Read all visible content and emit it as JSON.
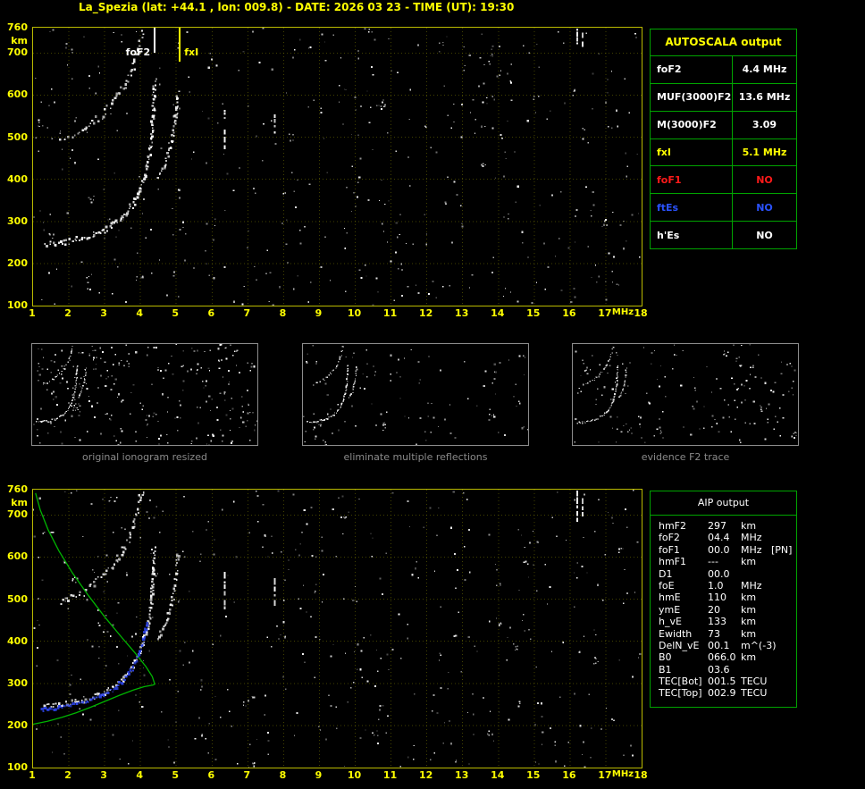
{
  "header": {
    "title": "La_Spezia (lat: +44.1 , lon: 009.8) - DATE: 2026 03 23 - TIME (UT): 19:30"
  },
  "autoscala_table": {
    "title": "AUTOSCALA output",
    "rows": [
      {
        "label": "foF2",
        "value": "4.4 MHz",
        "color": "#ffffff"
      },
      {
        "label": "MUF(3000)F2",
        "value": "13.6 MHz",
        "color": "#ffffff"
      },
      {
        "label": "M(3000)F2",
        "value": "3.09",
        "color": "#ffffff"
      },
      {
        "label": "fxI",
        "value": "5.1 MHz",
        "color": "#ffff00"
      },
      {
        "label": "foF1",
        "value": "NO",
        "color": "#ff1a1a"
      },
      {
        "label": "ftEs",
        "value": "NO",
        "color": "#2a52ff"
      },
      {
        "label": "h'Es",
        "value": "NO",
        "color": "#ffffff"
      }
    ]
  },
  "aip_table": {
    "title": "AIP output",
    "rows": [
      {
        "label": "hmF2",
        "value": "297",
        "unit": "km",
        "extra": ""
      },
      {
        "label": "foF2",
        "value": "04.4",
        "unit": "MHz",
        "extra": ""
      },
      {
        "label": "foF1",
        "value": "00.0",
        "unit": "MHz",
        "extra": "[PN]"
      },
      {
        "label": "hmF1",
        "value": "---",
        "unit": "km",
        "extra": ""
      },
      {
        "label": "D1",
        "value": "00.0",
        "unit": "",
        "extra": ""
      },
      {
        "label": "foE",
        "value": "1.0",
        "unit": "MHz",
        "extra": ""
      },
      {
        "label": "hmE",
        "value": "110",
        "unit": "km",
        "extra": ""
      },
      {
        "label": "ymE",
        "value": "20",
        "unit": "km",
        "extra": ""
      },
      {
        "label": "h_vE",
        "value": "133",
        "unit": "km",
        "extra": ""
      },
      {
        "label": "Ewidth",
        "value": "73",
        "unit": "km",
        "extra": ""
      },
      {
        "label": "DelN_vE",
        "value": "00.1",
        "unit": "m^(-3)",
        "extra": ""
      },
      {
        "label": "B0",
        "value": "066.0",
        "unit": "km",
        "extra": ""
      },
      {
        "label": "B1",
        "value": "03.6",
        "unit": "",
        "extra": ""
      },
      {
        "label": "TEC[Bot]",
        "value": "001.5",
        "unit": "TECU",
        "extra": ""
      },
      {
        "label": "TEC[Top]",
        "value": "002.9",
        "unit": "TECU",
        "extra": ""
      }
    ]
  },
  "thumbnails": [
    {
      "caption": "original ionogram resized"
    },
    {
      "caption": "eliminate multiple reflections"
    },
    {
      "caption": "evidence F2 trace"
    }
  ],
  "chart_data": {
    "type": "scatter",
    "title": "Ionogram - virtual height (km) vs sounding frequency (MHz)",
    "x_axis": {
      "label": "MHz",
      "min": 1,
      "max": 18,
      "ticks": [
        1,
        2,
        3,
        4,
        5,
        6,
        7,
        8,
        9,
        10,
        11,
        12,
        13,
        14,
        15,
        16,
        17,
        18
      ]
    },
    "y_axis": {
      "label": "km",
      "min": 100,
      "max": 760,
      "ticks": [
        100,
        200,
        300,
        400,
        500,
        600,
        700,
        760
      ]
    },
    "grid_color": "#6e6e00",
    "dot_color": "#ffffff",
    "markers": [
      {
        "name": "foF2",
        "freq": 4.4,
        "color": "#ffffff"
      },
      {
        "name": "fxI",
        "freq": 5.1,
        "color": "#ffff00"
      }
    ],
    "traces": {
      "f2_ordinary": [
        [
          1.35,
          247
        ],
        [
          1.7,
          249
        ],
        [
          2.05,
          253
        ],
        [
          2.4,
          259
        ],
        [
          2.75,
          268
        ],
        [
          3.05,
          281
        ],
        [
          3.35,
          298
        ],
        [
          3.6,
          318
        ],
        [
          3.85,
          348
        ],
        [
          4.05,
          388
        ],
        [
          4.2,
          432
        ],
        [
          4.3,
          488
        ],
        [
          4.36,
          555
        ],
        [
          4.4,
          622
        ]
      ],
      "f2_second_hop": [
        [
          1.8,
          495
        ],
        [
          2.15,
          505
        ],
        [
          2.5,
          522
        ],
        [
          2.85,
          545
        ],
        [
          3.15,
          572
        ],
        [
          3.45,
          605
        ],
        [
          3.7,
          645
        ],
        [
          3.9,
          692
        ],
        [
          4.02,
          735
        ],
        [
          4.08,
          758
        ]
      ],
      "x_mode": [
        [
          4.5,
          408
        ],
        [
          4.7,
          440
        ],
        [
          4.85,
          480
        ],
        [
          4.95,
          525
        ],
        [
          5.02,
          572
        ],
        [
          5.06,
          612
        ]
      ],
      "rfi_columns": [
        {
          "freq": 6.35,
          "heights": [
            480,
            565
          ]
        },
        {
          "freq": 7.75,
          "heights": [
            492,
            568
          ]
        },
        {
          "freq": 16.2,
          "heights": [
            688,
            758
          ]
        },
        {
          "freq": 16.35,
          "heights": [
            700,
            758
          ]
        }
      ]
    },
    "overlays": {
      "electron_density_profile": {
        "color": "#00b400",
        "points": [
          [
            1.0,
            203
          ],
          [
            1.4,
            210
          ],
          [
            1.8,
            219
          ],
          [
            2.2,
            230
          ],
          [
            2.6,
            243
          ],
          [
            3.0,
            257
          ],
          [
            3.4,
            271
          ],
          [
            3.8,
            284
          ],
          [
            4.1,
            292
          ],
          [
            4.35,
            296
          ],
          [
            4.4,
            298
          ],
          [
            4.33,
            316
          ],
          [
            4.15,
            340
          ],
          [
            3.85,
            372
          ],
          [
            3.45,
            412
          ],
          [
            3.0,
            458
          ],
          [
            2.55,
            508
          ],
          [
            2.1,
            562
          ],
          [
            1.72,
            615
          ],
          [
            1.42,
            665
          ],
          [
            1.2,
            712
          ],
          [
            1.07,
            752
          ]
        ]
      },
      "autoscaled_trace": {
        "color": "#2c43e8",
        "points": [
          [
            1.25,
            237
          ],
          [
            1.6,
            240
          ],
          [
            1.95,
            245
          ],
          [
            2.3,
            251
          ],
          [
            2.65,
            260
          ],
          [
            2.95,
            271
          ],
          [
            3.25,
            286
          ],
          [
            3.5,
            304
          ],
          [
            3.75,
            330
          ],
          [
            3.95,
            365
          ],
          [
            4.1,
            405
          ],
          [
            4.2,
            448
          ]
        ]
      }
    }
  }
}
